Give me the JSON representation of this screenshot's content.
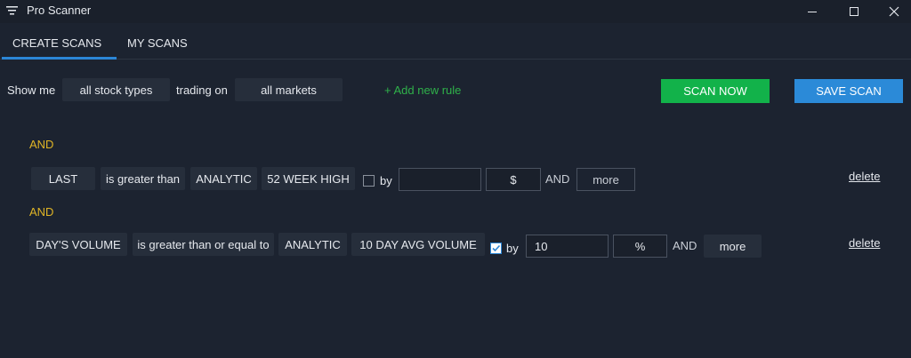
{
  "window": {
    "title": "Pro Scanner",
    "icons": {
      "app": "filter-icon",
      "minimize": "minimize-icon",
      "maximize": "maximize-icon",
      "close": "close-icon"
    }
  },
  "tabs": [
    {
      "label": "CREATE SCANS",
      "active": true
    },
    {
      "label": "MY SCANS",
      "active": false
    }
  ],
  "toolbar": {
    "show_me_label": "Show me",
    "stock_types": "all stock types",
    "trading_on_label": "trading on",
    "markets": "all markets",
    "add_rule": "+ Add new rule",
    "scan_now": "SCAN NOW",
    "save_scan": "SAVE SCAN"
  },
  "rules": [
    {
      "connector": "AND",
      "field": "LAST",
      "operator": "is greater than",
      "type": "ANALYTIC",
      "analytic": "52 WEEK HIGH",
      "by_checked": false,
      "by_label": "by",
      "value": "",
      "unit": "$",
      "and_label": "AND",
      "more": "more",
      "delete": "delete"
    },
    {
      "connector": "AND",
      "field": "DAY'S VOLUME",
      "operator": "is greater than or equal to",
      "type": "ANALYTIC",
      "analytic": "10 DAY AVG VOLUME",
      "by_checked": true,
      "by_label": "by",
      "value": "10",
      "unit": "%",
      "and_label": "AND",
      "more": "more",
      "delete": "delete"
    }
  ],
  "colors": {
    "background": "#1c2330",
    "accent": "#2b86d6",
    "scan_now": "#12b24a",
    "save_scan": "#2b8ad8",
    "add_rule": "#2fb14a",
    "connector": "#e0b526"
  }
}
